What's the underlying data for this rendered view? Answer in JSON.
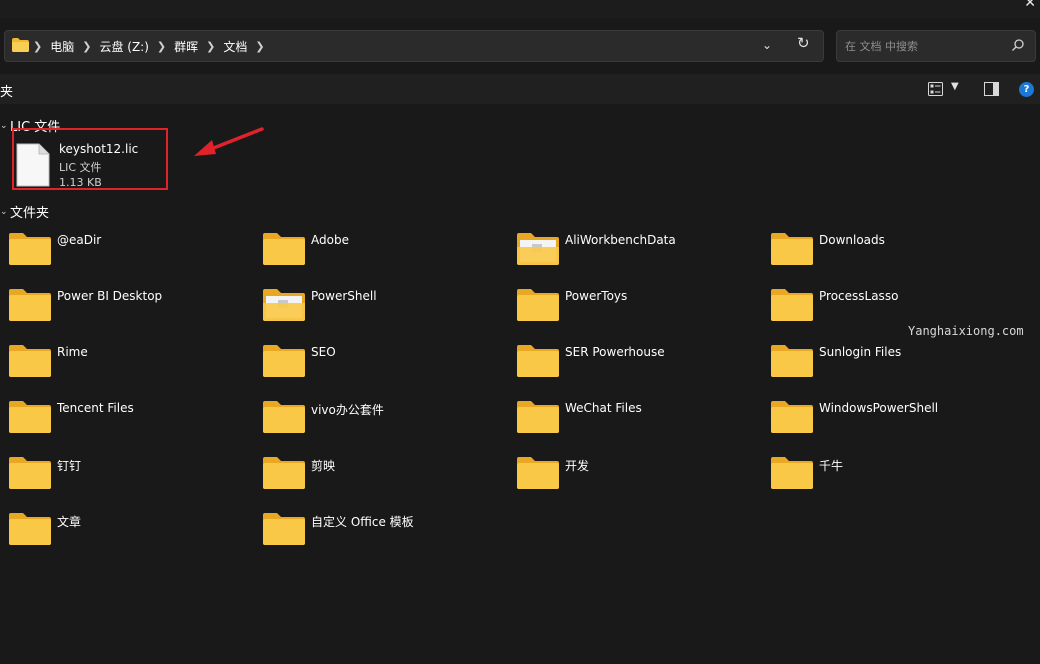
{
  "address": {
    "crumbs": [
      "电脑",
      "云盘 (Z:)",
      "群晖",
      "文档"
    ]
  },
  "search": {
    "placeholder": "在 文档 中搜索"
  },
  "toolbar": {
    "title": "夹"
  },
  "groups": {
    "lic": "LIC 文件",
    "folders": "文件夹"
  },
  "file": {
    "name": "keyshot12.lic",
    "type": "LIC 文件",
    "size": "1.13 KB"
  },
  "folders": [
    {
      "label": "@eaDir",
      "variant": "plain"
    },
    {
      "label": "Adobe",
      "variant": "plain"
    },
    {
      "label": "AliWorkbenchData",
      "variant": "content"
    },
    {
      "label": "Downloads",
      "variant": "plain"
    },
    {
      "label": "Power BI Desktop",
      "variant": "plain"
    },
    {
      "label": "PowerShell",
      "variant": "content"
    },
    {
      "label": "PowerToys",
      "variant": "plain"
    },
    {
      "label": "ProcessLasso",
      "variant": "plain"
    },
    {
      "label": "Rime",
      "variant": "plain"
    },
    {
      "label": "SEO",
      "variant": "plain"
    },
    {
      "label": "SER Powerhouse",
      "variant": "plain"
    },
    {
      "label": "Sunlogin Files",
      "variant": "plain"
    },
    {
      "label": "Tencent Files",
      "variant": "plain"
    },
    {
      "label": "vivo办公套件",
      "variant": "plain"
    },
    {
      "label": "WeChat Files",
      "variant": "plain"
    },
    {
      "label": "WindowsPowerShell",
      "variant": "plain"
    },
    {
      "label": "钉钉",
      "variant": "plain"
    },
    {
      "label": "剪映",
      "variant": "plain"
    },
    {
      "label": "开发",
      "variant": "plain"
    },
    {
      "label": "千牛",
      "variant": "plain"
    },
    {
      "label": "文章",
      "variant": "plain"
    },
    {
      "label": "自定义 Office 模板",
      "variant": "plain"
    }
  ],
  "watermark": "Yanghaixiong.com",
  "colors": {
    "background": "#191919",
    "folder_yellow": "#f5c141",
    "highlight_red": "#e0222a",
    "accent_blue": "#1a78d6"
  }
}
